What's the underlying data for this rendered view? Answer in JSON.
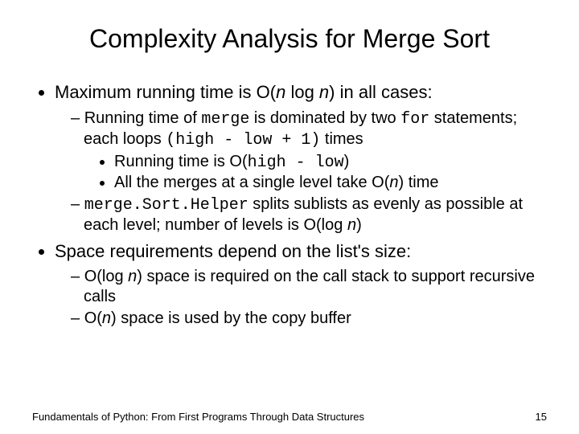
{
  "title": "Complexity Analysis for Merge Sort",
  "b1": {
    "text_a": "Maximum running time is O(",
    "n1": "n",
    "text_b": " log ",
    "n2": "n",
    "text_c": ") in all cases:",
    "s1": {
      "a": "Running time of ",
      "merge": "merge",
      "b": " is dominated by two ",
      "for": "for",
      "c": " statements; each loops ",
      "expr": "(high - low + 1)",
      "d": " times",
      "ss1": {
        "a": "Running time is O(",
        "expr": "high - low",
        "b": ")"
      },
      "ss2": {
        "a": "All the merges at a single level take O(",
        "n": "n",
        "b": ") time"
      }
    },
    "s2": {
      "helper": "merge.Sort.Helper",
      "a": " splits sublists as evenly as possible at each level; number of levels is O(log ",
      "n": "n",
      "b": ")"
    }
  },
  "b2": {
    "text": "Space requirements depend on the list's size:",
    "s1": {
      "a": "O(log ",
      "n": "n",
      "b": ") space is required on the call stack to support recursive calls"
    },
    "s2": {
      "a": "O(",
      "n": "n",
      "b": ") space is used by the copy buffer"
    }
  },
  "footer": {
    "left": "Fundamentals of Python: From First Programs Through Data Structures",
    "right": "15"
  }
}
